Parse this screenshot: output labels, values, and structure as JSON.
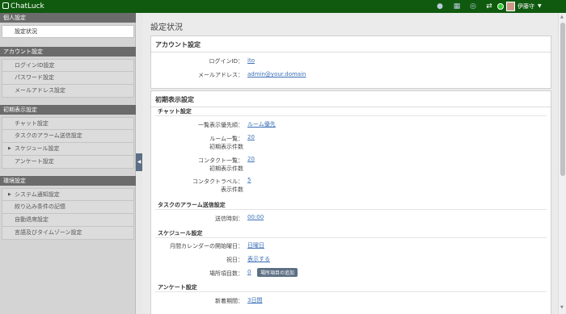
{
  "app": {
    "name": "ChatLuck"
  },
  "topbar": {
    "icons": [
      "person-icon",
      "layers-icon",
      "globe-icon",
      "swap-icon",
      "status-icon"
    ],
    "user_name": "伊藤守",
    "status_color": "#2ecc2e"
  },
  "sidebar": {
    "sections": [
      {
        "title": "個人設定",
        "items": [
          {
            "label": "設定状況",
            "active": true
          }
        ]
      },
      {
        "title": "アカウント設定",
        "items": [
          {
            "label": "ログインID設定"
          },
          {
            "label": "パスワード設定"
          },
          {
            "label": "メールアドレス設定"
          }
        ]
      },
      {
        "title": "初期表示設定",
        "items": [
          {
            "label": "チャット設定"
          },
          {
            "label": "タスクのアラーム送信設定"
          },
          {
            "label": "スケジュール設定",
            "caret": true
          },
          {
            "label": "アンケート設定"
          }
        ]
      },
      {
        "title": "環境設定",
        "items": [
          {
            "label": "システム通知設定",
            "caret": true
          },
          {
            "label": "絞り込み条件の記憶"
          },
          {
            "label": "自動退席設定"
          },
          {
            "label": "言語及びタイムゾーン設定"
          }
        ]
      }
    ]
  },
  "main": {
    "title": "設定状況",
    "account_panel": {
      "title": "アカウント設定",
      "login_id_label": "ログインID：",
      "login_id": "ito",
      "email_label": "メールアドレス：",
      "email": "admin@your.domain"
    },
    "initial_panel": {
      "title": "初期表示設定",
      "chat": {
        "heading": "チャット設定",
        "list_priority_label": "一覧表示優先順：",
        "list_priority": "ルーム優先",
        "room_list_label": "ルーム一覧",
        "room_list_sub": "初期表示件数",
        "room_list_value": "20",
        "contact_list_label": "コンタクト一覧",
        "contact_list_sub": "初期表示件数",
        "contact_list_value": "20",
        "contact_travel_label": "コンタクトラベル",
        "contact_travel_sub": "表示件数",
        "contact_travel_value": "5"
      },
      "task_alarm": {
        "heading": "タスクのアラーム送信設定",
        "send_time_label": "送信時刻：",
        "send_time": "00:00"
      },
      "schedule": {
        "heading": "スケジュール設定",
        "start_day_label": "月間カレンダーの開始曜日：",
        "start_day": "日曜日",
        "holiday_label": "祝日：",
        "holiday": "表示する",
        "place_count_label": "場所項目数：",
        "place_count": "0",
        "add_place_button": "場所項目の追加"
      },
      "survey": {
        "heading": "アンケート設定",
        "new_period_label": "新着期間：",
        "new_period": "3日間"
      }
    }
  }
}
